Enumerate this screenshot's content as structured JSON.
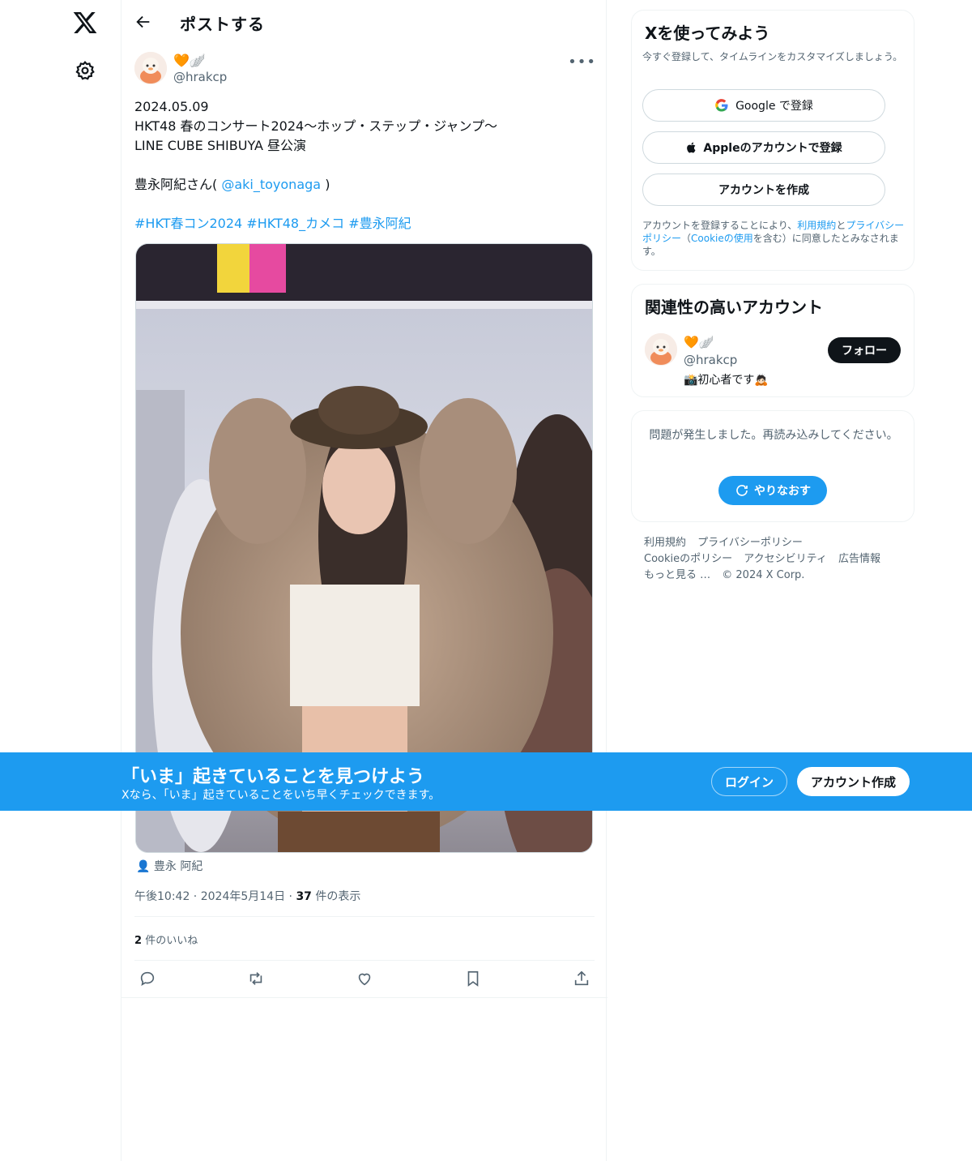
{
  "nav": {
    "logo_icon": "x-logo-icon",
    "settings_icon": "gear-icon"
  },
  "header": {
    "title": "ポストする"
  },
  "post": {
    "author_name": "🧡🪽",
    "author_handle": "@hrakcp",
    "text_lines": [
      "2024.05.09",
      "HKT48 春のコンサート2024〜ホップ・ステップ・ジャンプ〜",
      "LINE CUBE SHIBUYA 昼公演"
    ],
    "mention_prefix": "豊永阿紀さん(",
    "mention": "@aki_toyonaga",
    "mention_suffix": ")",
    "hashtags": [
      "#HKT春コン2024",
      "#HKT48_カメコ",
      "#豊永阿紀"
    ],
    "tagged_person": "豊永 阿紀",
    "time": "午後10:42",
    "date": "2024年5月14日",
    "views_count": "37",
    "views_label": "件の表示",
    "likes_count": "2",
    "likes_label": "件のいいね"
  },
  "signup_card": {
    "title": "Xを使ってみよう",
    "subtitle": "今すぐ登録して、タイムラインをカスタマイズしましょう。",
    "google_label": "Google で登録",
    "apple_label": "Appleのアカウントで登録",
    "create_label": "アカウントを作成",
    "legal_1": "アカウントを登録することにより、",
    "legal_terms": "利用規約",
    "legal_2": "と",
    "legal_privacy": "プライバシーポリシー",
    "legal_3": "（",
    "legal_cookie": "Cookieの使用",
    "legal_4": "を含む）に同意したとみなされます。"
  },
  "related_card": {
    "title": "関連性の高いアカウント",
    "name": "🧡🪽",
    "handle": "@hrakcp",
    "bio": "📸初心者です🙇🏻",
    "follow_label": "フォロー"
  },
  "error_card": {
    "message": "問題が発生しました。再読み込みしてください。",
    "retry_label": "やりなおす"
  },
  "footer": {
    "links_row1": [
      "利用規約",
      "プライバシーポリシー"
    ],
    "links_row2": [
      "Cookieのポリシー",
      "アクセシビリティ",
      "広告情報"
    ],
    "more": "もっと見る …",
    "copyright": "© 2024 X Corp."
  },
  "banner": {
    "headline": "「いま」起きていることを見つけよう",
    "subline": "Xなら、「いま」起きていることをいち早くチェックできます。",
    "login_label": "ログイン",
    "signup_label": "アカウント作成"
  },
  "colors": {
    "accent": "#1d9bf0",
    "text": "#0f1419",
    "muted": "#536471",
    "border": "#eff3f4"
  }
}
